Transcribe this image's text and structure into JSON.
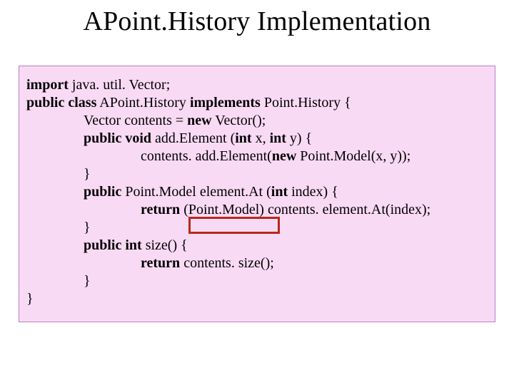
{
  "title": "APoint.History Implementation",
  "code": {
    "l1_kw": "import",
    "l1_rest": " java. util. Vector;",
    "l2_kw1": "public class",
    "l2_mid": " APoint.History ",
    "l2_kw2": "implements",
    "l2_rest": " Point.History {",
    "l3_pre": "Vector contents = ",
    "l3_kw": "new",
    "l3_rest": " Vector();",
    "l4_kw1": "public void",
    "l4_mid": " add.Element (",
    "l4_kw2": "int",
    "l4_mid2": " x, ",
    "l4_kw3": "int",
    "l4_rest": " y) {",
    "l5_pre": "contents. add.Element(",
    "l5_kw": "new",
    "l5_rest": " Point.Model(x, y));",
    "l6": "}",
    "l7_kw": "public",
    "l7_mid": " Point.Model element.At (",
    "l7_kw2": "int",
    "l7_rest": " index) {",
    "l8_kw": "return",
    "l8_rest": " (Point.Model) contents. element.At(index);",
    "l9": "}",
    "l10_kw": "public int",
    "l10_rest": " size() {",
    "l11_kw": "return",
    "l11_rest": " contents. size();",
    "l12": "}",
    "l13": "}"
  }
}
